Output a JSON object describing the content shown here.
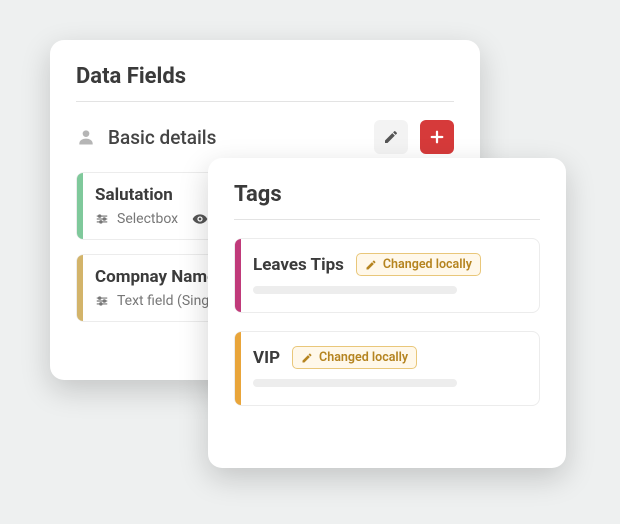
{
  "dataFields": {
    "title": "Data Fields",
    "section": {
      "title": "Basic details"
    },
    "fields": [
      {
        "name": "Salutation",
        "type": "Selectbox",
        "accent": "#7fc99b"
      },
      {
        "name": "Compnay Name",
        "type": "Text field (Single line)",
        "accent": "#d3b46a"
      }
    ]
  },
  "tags": {
    "title": "Tags",
    "badgeLabel": "Changed locally",
    "items": [
      {
        "name": "Leaves Tips",
        "accent": "#c03a7a"
      },
      {
        "name": "VIP",
        "accent": "#e9a53a"
      }
    ]
  }
}
